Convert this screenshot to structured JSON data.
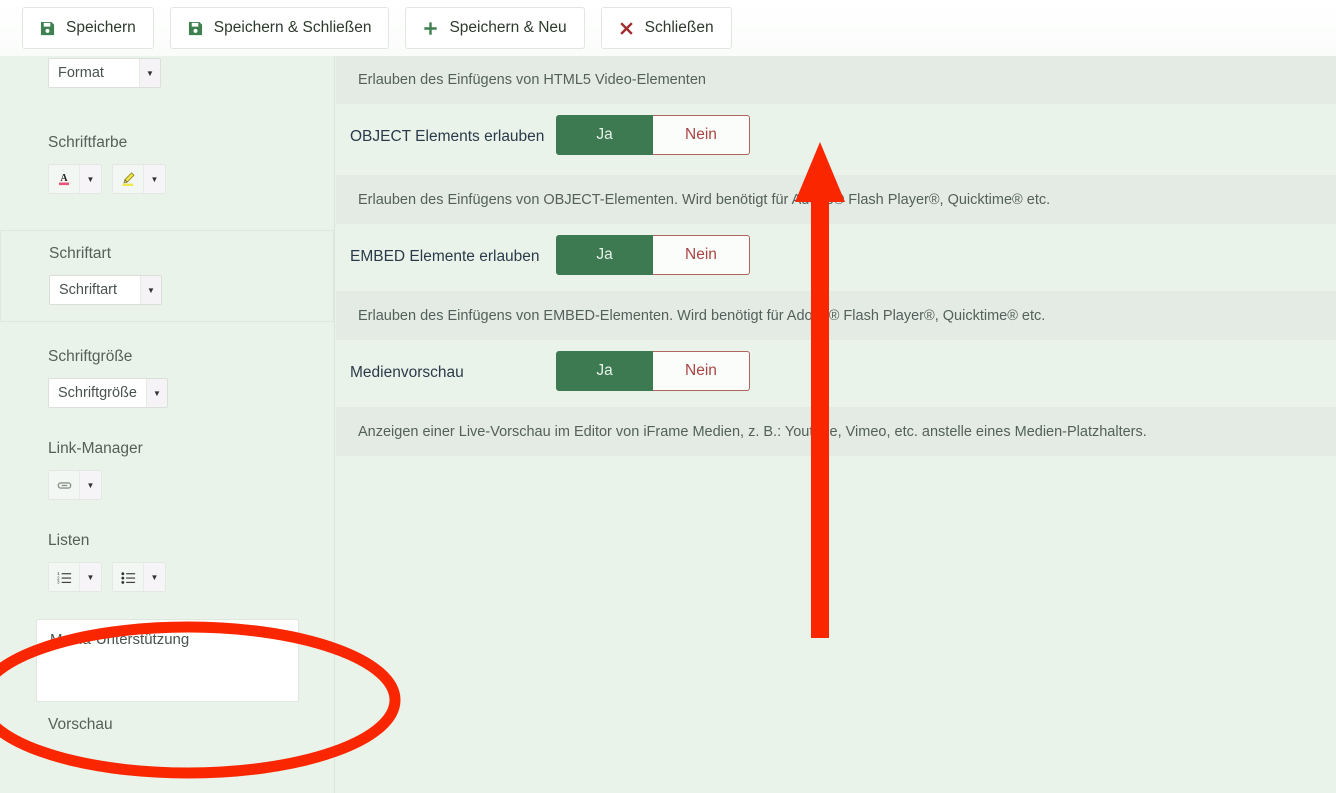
{
  "toolbar": {
    "buttons": [
      {
        "label": "Speichern",
        "icon": "save-icon"
      },
      {
        "label": "Speichern & Schließen",
        "icon": "save-icon"
      },
      {
        "label": "Speichern & Neu",
        "icon": "plus-icon"
      },
      {
        "label": "Schließen",
        "icon": "close-x-icon"
      }
    ]
  },
  "colors": {
    "accent_green": "#3d7a52",
    "deny_red": "#a94442",
    "annotation_red": "#fa2600",
    "panel_bg": "#eaf3ea",
    "desc_bg": "#e4ebe4",
    "label_blue": "#2b3a4a",
    "save_icon_green": "#3f8050",
    "close_icon_red": "#a02c2c"
  },
  "sidebar": {
    "groups": [
      {
        "name": "format",
        "label": null,
        "controls": [
          {
            "type": "combo",
            "value": "Format",
            "icon": "chevron-down-icon"
          }
        ]
      },
      {
        "name": "schriftfarbe",
        "label": "Schriftfarbe",
        "controls": [
          {
            "type": "iconbtn",
            "icon": "font-color-icon",
            "arrow": "chevron-down-icon"
          },
          {
            "type": "iconbtn",
            "icon": "highlighter-icon",
            "arrow": "chevron-down-icon"
          }
        ]
      },
      {
        "name": "schriftart",
        "label": "Schriftart",
        "boxed": true,
        "controls": [
          {
            "type": "combo",
            "value": "Schriftart",
            "icon": "chevron-down-icon"
          }
        ]
      },
      {
        "name": "schriftgroesse",
        "label": "Schriftgröße",
        "controls": [
          {
            "type": "combo",
            "value": "Schriftgröße",
            "icon": "chevron-down-icon"
          }
        ]
      },
      {
        "name": "link-manager",
        "label": "Link-Manager",
        "controls": [
          {
            "type": "iconbtn",
            "icon": "link-chain-icon",
            "arrow": "chevron-down-icon"
          }
        ]
      },
      {
        "name": "listen",
        "label": "Listen",
        "controls": [
          {
            "type": "iconbtn",
            "icon": "ordered-list-icon",
            "arrow": "chevron-down-icon"
          },
          {
            "type": "iconbtn",
            "icon": "unordered-list-icon",
            "arrow": "chevron-down-icon"
          }
        ]
      }
    ],
    "textbox": {
      "value": "Media-Unterstützung"
    },
    "footer_label": "Vorschau"
  },
  "main": {
    "top_description": "Erlauben des Einfügens von HTML5 Video-Elementen",
    "settings": [
      {
        "label": "OBJECT Elements erlauben",
        "yes_label": "Ja",
        "no_label": "Nein",
        "selected": "Ja",
        "description": "Erlauben des Einfügens von OBJECT-Elementen. Wird benötigt für Adobe® Flash Player®, Quicktime® etc."
      },
      {
        "label": "EMBED Elemente erlauben",
        "yes_label": "Ja",
        "no_label": "Nein",
        "selected": "Ja",
        "description": "Erlauben des Einfügens von EMBED-Elementen. Wird benötigt für Adobe® Flash Player®, Quicktime® etc."
      },
      {
        "label": "Medienvorschau",
        "yes_label": "Ja",
        "no_label": "Nein",
        "selected": "Ja",
        "description": "Anzeigen einer Live-Vorschau im Editor von iFrame Medien, z. B.: Youtube, Vimeo, etc. anstelle eines Medien-Platzhalters."
      }
    ]
  },
  "annotations": {
    "arrow": {
      "name": "red-up-arrow-annotation",
      "color": "#fa2600",
      "direction": "up"
    },
    "ellipse": {
      "name": "red-ellipse-annotation",
      "color": "#fa2600"
    }
  }
}
